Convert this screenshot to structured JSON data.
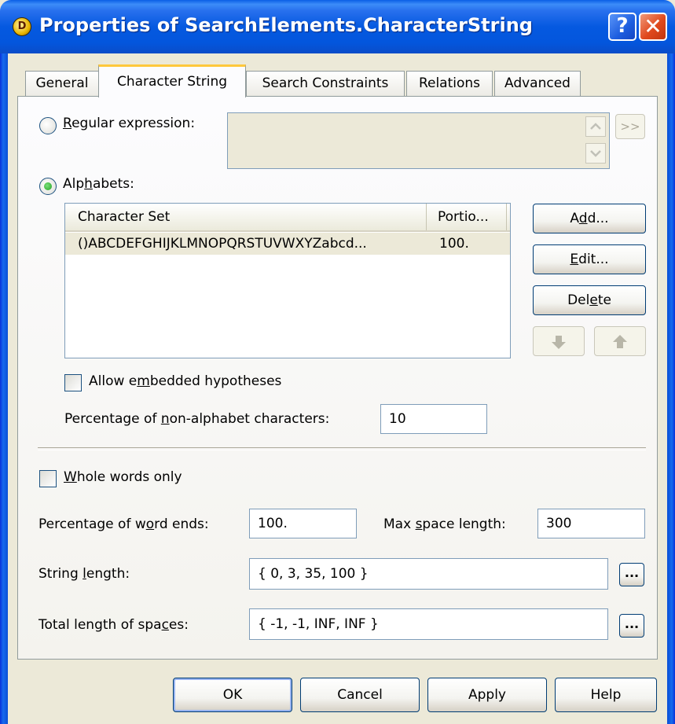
{
  "window": {
    "title": "Properties of SearchElements.CharacterString",
    "help_button": "?",
    "close_button": "✕"
  },
  "tabs": [
    {
      "label": "General",
      "active": false
    },
    {
      "label": "Character String",
      "active": true
    },
    {
      "label": "Search Constraints",
      "active": false
    },
    {
      "label": "Relations",
      "active": false
    },
    {
      "label": "Advanced",
      "active": false
    }
  ],
  "regex": {
    "label_prefix": "",
    "label_mnemonic": "R",
    "label_rest": "egular expression:",
    "selected": false,
    "value": "",
    "expand_button": ">>"
  },
  "alphabets": {
    "label_prefix": "Alp",
    "label_mnemonic": "h",
    "label_rest": "abets:",
    "selected": true,
    "list": {
      "columns": [
        "Character Set",
        "Portio..."
      ],
      "rows": [
        {
          "character_set": "()ABCDEFGHIJKLMNOPQRSTUVWXYZabcd...",
          "portion": "100."
        }
      ]
    },
    "buttons": {
      "add": {
        "prefix": "A",
        "mnemonic": "d",
        "rest": "d..."
      },
      "edit": {
        "prefix": "",
        "mnemonic": "E",
        "rest": "dit..."
      },
      "delete": {
        "prefix": "Del",
        "mnemonic": "e",
        "rest": "te"
      },
      "move_down_icon": "arrow-down",
      "move_up_icon": "arrow-up"
    },
    "allow_embedded": {
      "prefix": "Allow e",
      "mnemonic": "m",
      "rest": "bedded hypotheses",
      "checked": false
    },
    "non_alphabet": {
      "prefix": "Percentage of ",
      "mnemonic": "n",
      "rest": "on-alphabet characters:",
      "value": "10"
    }
  },
  "whole_words": {
    "prefix": "",
    "mnemonic": "W",
    "rest": "hole words only",
    "checked": false
  },
  "word_ends": {
    "prefix": "Percentage of w",
    "mnemonic": "o",
    "rest": "rd ends:",
    "value": "100."
  },
  "max_space": {
    "prefix": "Max ",
    "mnemonic": "s",
    "rest": "pace length:",
    "value": "300"
  },
  "string_length": {
    "prefix": "String ",
    "mnemonic": "l",
    "rest": "ength:",
    "value": "{ 0, 3, 35, 100 }",
    "browse": "..."
  },
  "total_spaces": {
    "prefix": "Total length of spa",
    "mnemonic": "c",
    "rest": "es:",
    "value": "{ -1, -1, INF, INF }",
    "browse": "..."
  },
  "footer": {
    "ok": "OK",
    "cancel": "Cancel",
    "apply": "Apply",
    "help": "Help"
  }
}
